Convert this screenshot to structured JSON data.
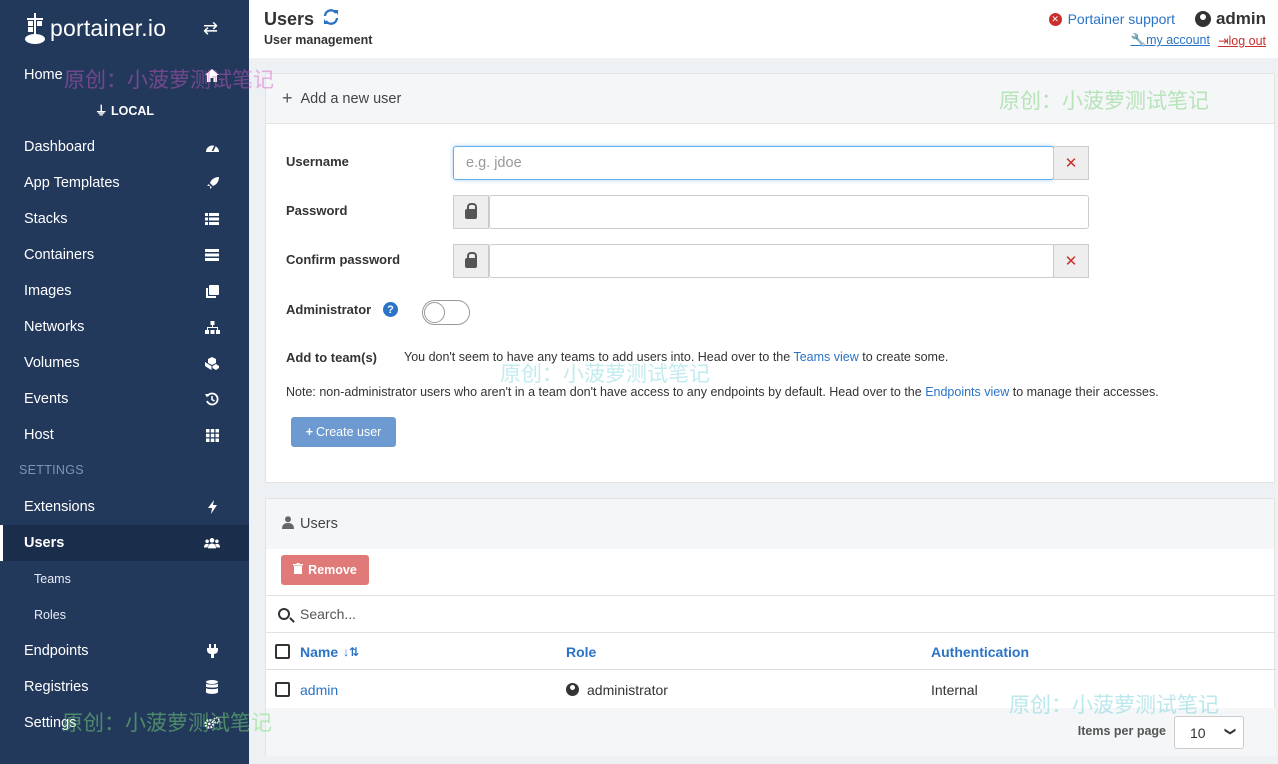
{
  "sidebar": {
    "brand": "portainer.io",
    "endpoint_label": "LOCAL",
    "settings_heading": "SETTINGS",
    "items": [
      {
        "label": "Home",
        "icon": "home-icon"
      },
      {
        "label": "Dashboard",
        "icon": "dashboard-icon"
      },
      {
        "label": "App Templates",
        "icon": "rocket-icon"
      },
      {
        "label": "Stacks",
        "icon": "list-icon"
      },
      {
        "label": "Containers",
        "icon": "server-icon"
      },
      {
        "label": "Images",
        "icon": "clone-icon"
      },
      {
        "label": "Networks",
        "icon": "sitemap-icon"
      },
      {
        "label": "Volumes",
        "icon": "cubes-icon"
      },
      {
        "label": "Events",
        "icon": "history-icon"
      },
      {
        "label": "Host",
        "icon": "grid-icon"
      },
      {
        "label": "Extensions",
        "icon": "bolt-icon"
      },
      {
        "label": "Users",
        "icon": "users-icon"
      },
      {
        "label": "Teams"
      },
      {
        "label": "Roles"
      },
      {
        "label": "Endpoints",
        "icon": "plug-icon"
      },
      {
        "label": "Registries",
        "icon": "database-icon"
      },
      {
        "label": "Settings",
        "icon": "cogs-icon"
      }
    ]
  },
  "header": {
    "title": "Users",
    "subtitle": "User management",
    "support": "Portainer support",
    "username": "admin",
    "my_account": "my account",
    "logout": "log out"
  },
  "add_user": {
    "heading": "Add a new user",
    "username_label": "Username",
    "username_placeholder": "e.g. jdoe",
    "password_label": "Password",
    "confirm_label": "Confirm password",
    "admin_label": "Administrator",
    "admin_enabled": false,
    "team_label": "Add to team(s)",
    "team_text_before": "You don't seem to have any teams to add users into. Head over to the",
    "team_link": "Teams view",
    "team_text_after": "to create some.",
    "note_before": "Note: non-administrator users who aren't in a team don't have access to any endpoints by default. Head over to the",
    "note_link": "Endpoints view",
    "note_after": "to manage their accesses.",
    "create_button": "Create user"
  },
  "users_table": {
    "heading": "Users",
    "remove_button": "Remove",
    "search_placeholder": "Search...",
    "columns": [
      "Name",
      "Role",
      "Authentication"
    ],
    "rows": [
      {
        "name": "admin",
        "role": "administrator",
        "auth": "Internal"
      }
    ],
    "items_per_page_label": "Items per page",
    "items_per_page": "10"
  },
  "watermark": "原创：小菠萝测试笔记",
  "colors": {
    "sidebar": "#23395c",
    "link": "#2a73c6",
    "danger": "#c9302c",
    "primary_button": "#6d9bd1",
    "remove_button": "#e07a78"
  }
}
